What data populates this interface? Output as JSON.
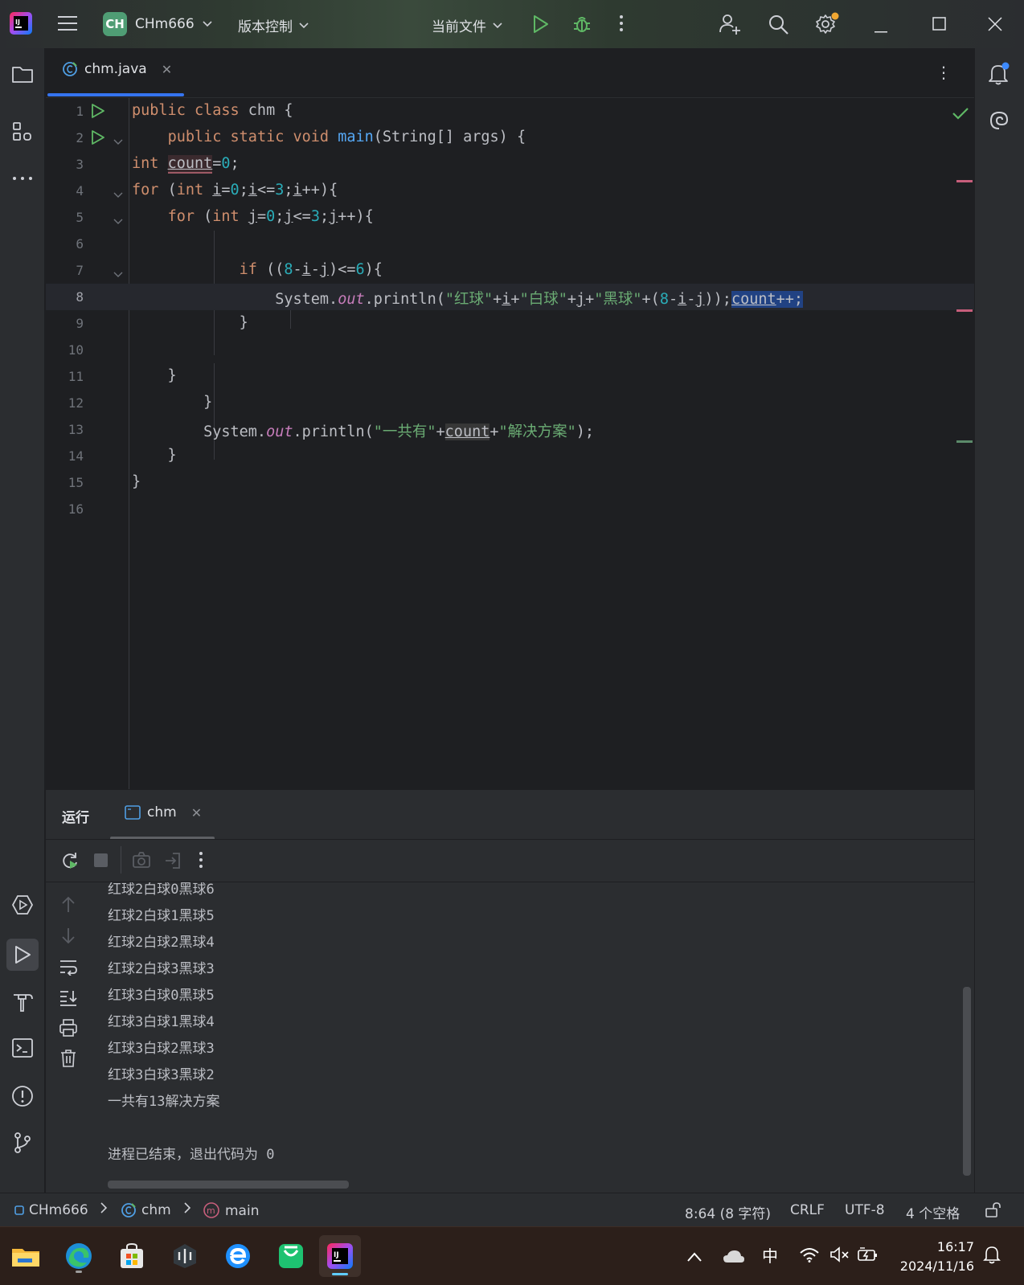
{
  "titlebar": {
    "project_badge": "CH",
    "project_name": "CHm666",
    "vcs_label": "版本控制",
    "run_config": "当前文件"
  },
  "editor": {
    "tab_label": "chm.java",
    "line_numbers": [
      "1",
      "2",
      "3",
      "4",
      "5",
      "6",
      "7",
      "8",
      "9",
      "10",
      "11",
      "12",
      "13",
      "14",
      "15",
      "16"
    ],
    "code_lines": [
      "public class chm {",
      "    public static void main(String[] args) {",
      "int count=0;",
      "for (int i=0;i<=3;i++){",
      "    for (int j=0;j<=3;j++){",
      "",
      "            if ((8-i-j)<=6){",
      "                System.out.println(\"红球\"+i+\"白球\"+j+\"黑球\"+(8-i-j));count++;",
      "            }",
      "",
      "    }",
      "        }",
      "        System.out.println(\"一共有\"+count+\"解决方案\");",
      "    }",
      "}",
      ""
    ],
    "current_line": 8
  },
  "run_panel": {
    "title": "运行",
    "tab_label": "chm",
    "output": [
      "红球2白球0黑球6",
      "红球2白球1黑球5",
      "红球2白球2黑球4",
      "红球2白球3黑球3",
      "红球3白球0黑球5",
      "红球3白球1黑球4",
      "红球3白球2黑球3",
      "红球3白球3黑球2",
      "一共有13解决方案",
      "",
      "进程已结束，退出代码为 0"
    ]
  },
  "statusbar": {
    "project": "CHm666",
    "class": "chm",
    "method": "main",
    "position": "8:64 (8 字符)",
    "line_sep": "CRLF",
    "encoding": "UTF-8",
    "indent": "4 个空格"
  },
  "taskbar": {
    "ime": "中",
    "time": "16:17",
    "date": "2024/11/16"
  },
  "colors": {
    "accent": "#3574f0",
    "keyword": "#cf8e6d",
    "string": "#6aab73",
    "number": "#2aacb8",
    "function": "#56a8f5",
    "run_green": "#5fb865"
  }
}
